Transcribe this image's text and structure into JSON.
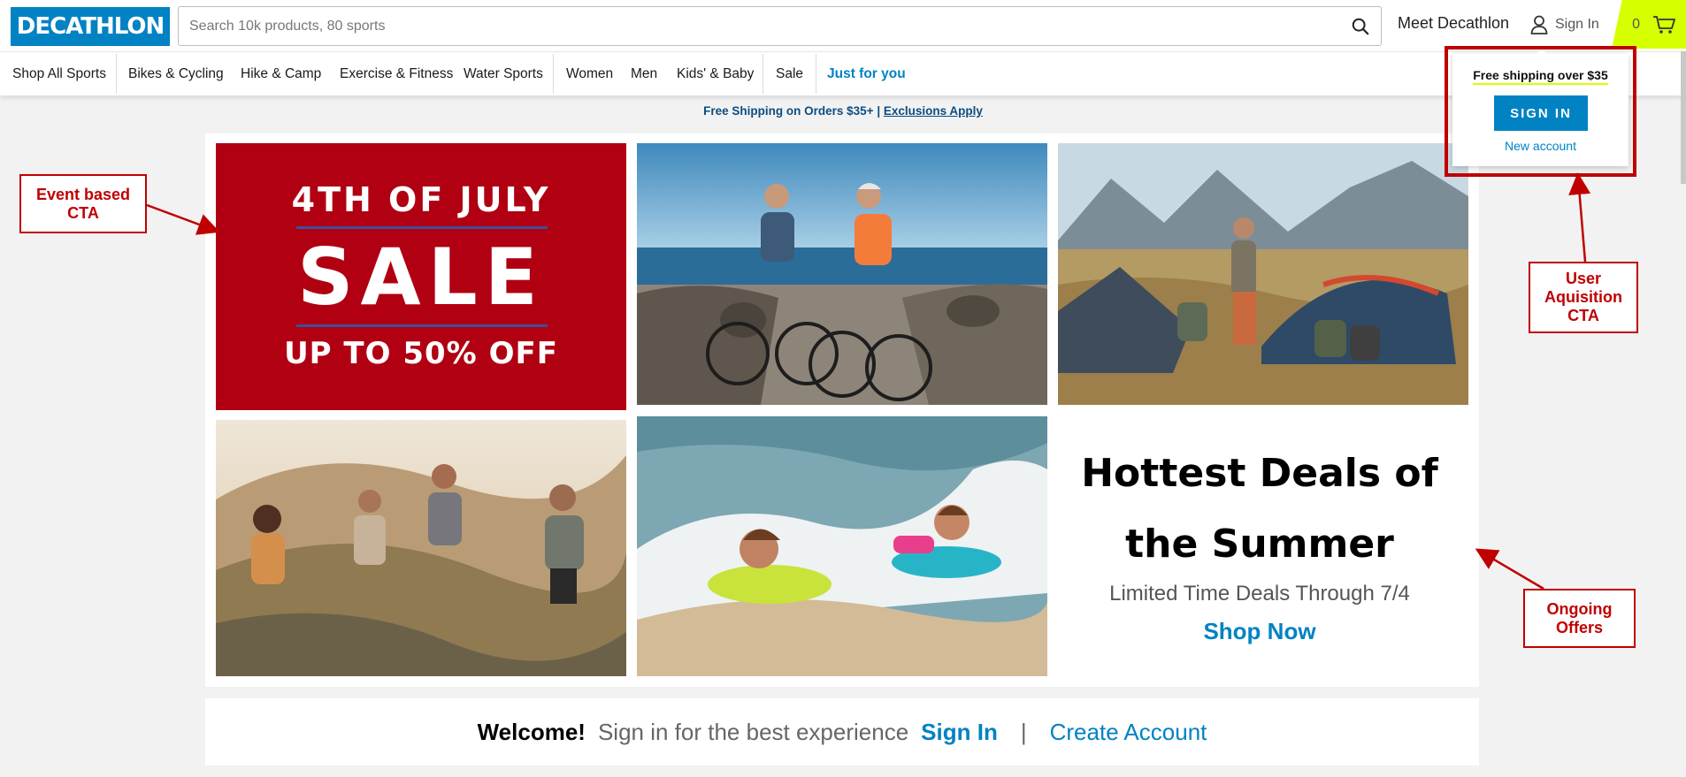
{
  "header": {
    "logo": "DECATHLON",
    "search_placeholder": "Search 10k products, 80 sports",
    "meet": "Meet Decathlon",
    "signin": "Sign In",
    "cart_count": "0",
    "accent_color": "#0082c3",
    "cart_color": "#d6ff00"
  },
  "nav": {
    "items": [
      "Shop All Sports",
      "Bikes & Cycling",
      "Hike & Camp",
      "Exercise & Fitness",
      "Water Sports",
      "Women",
      "Men",
      "Kids' & Baby",
      "Sale",
      "Just for you"
    ]
  },
  "shipping_banner": {
    "text": "Free Shipping on Orders $35+",
    "separator": "|",
    "link": "Exclusions Apply"
  },
  "hero": {
    "sale_line1": "4TH OF JULY",
    "sale_line2": "SALE",
    "sale_line3": "UP TO 50% OFF",
    "photos": [
      "cycling-photo",
      "camping-photo",
      "hiking-photo",
      "bodyboard-photo"
    ],
    "deals_title": "Hottest Deals of the Summer",
    "deals_sub": "Limited Time Deals Through 7/4",
    "shop_now": "Shop Now"
  },
  "welcome": {
    "greeting": "Welcome!",
    "message": "Sign in for the best experience",
    "signin": "Sign In",
    "separator": "|",
    "create": "Create Account"
  },
  "dropdown": {
    "shipping": "Free shipping over $35",
    "button": "SIGN IN",
    "new_account": "New account"
  },
  "annotations": {
    "event": "Event based CTA",
    "user": "User Aquisition CTA",
    "ongoing": "Ongoing Offers"
  }
}
